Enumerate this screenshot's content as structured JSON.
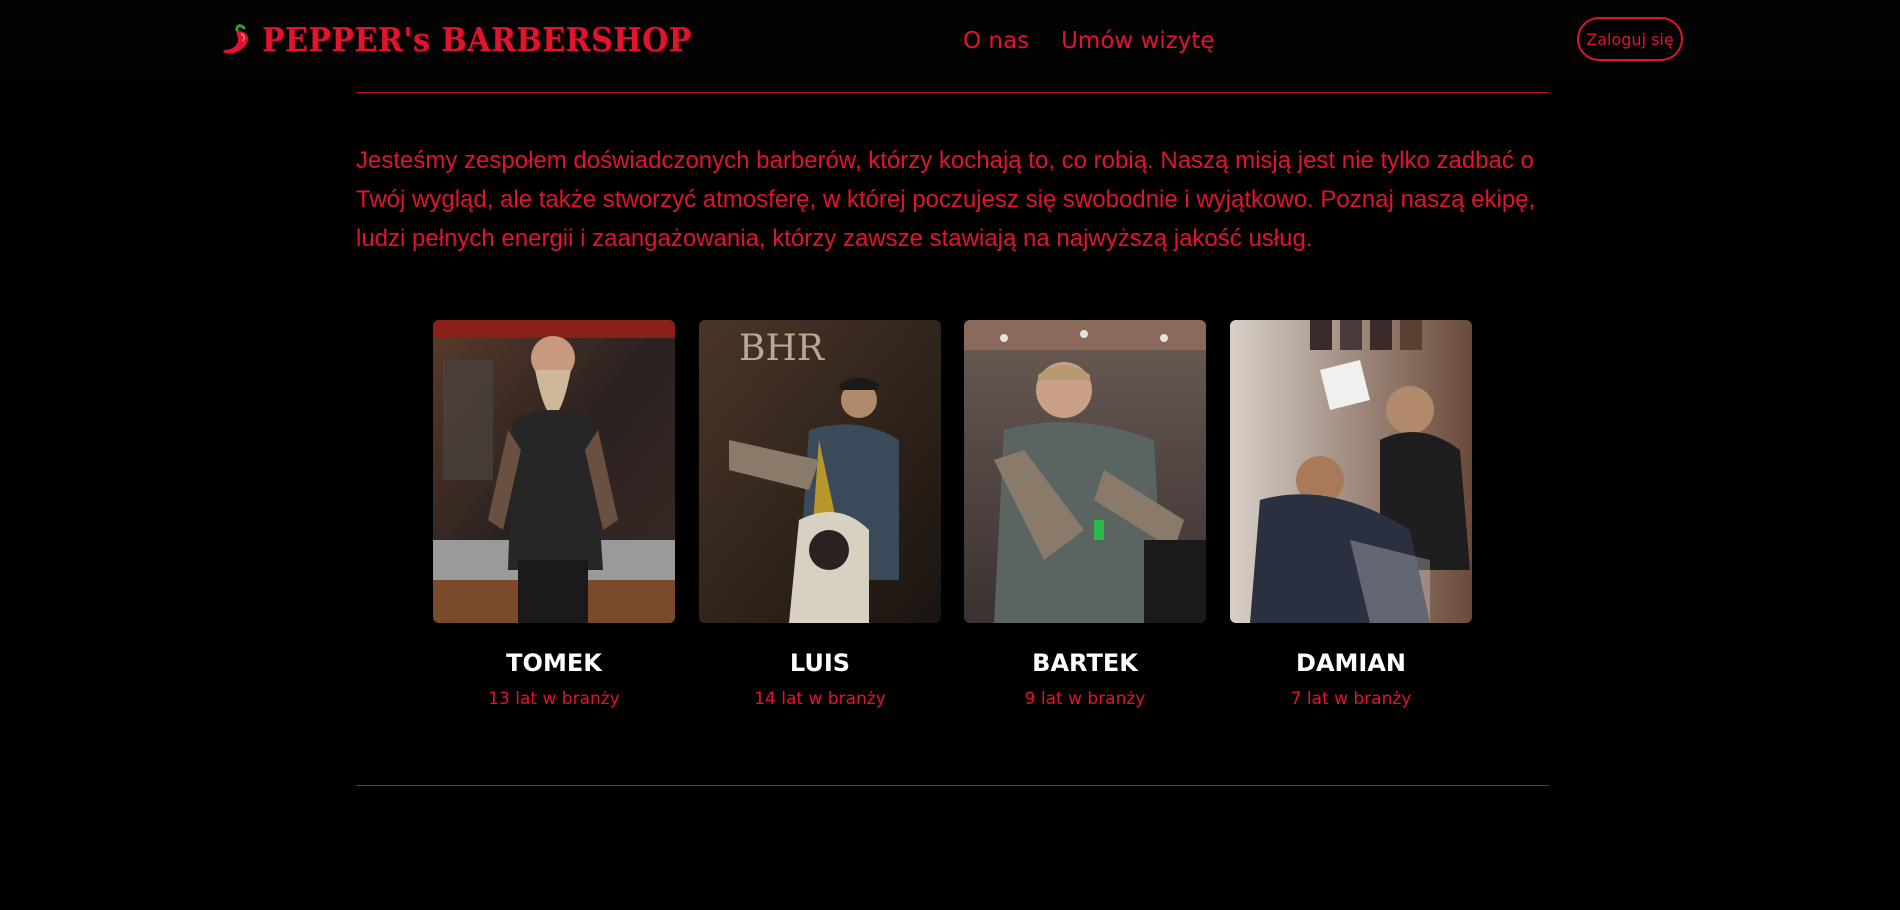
{
  "header": {
    "brand": "PEPPER's BARBERSHOP",
    "logo_icon": "chili-pepper-icon",
    "nav": [
      {
        "label": "O nas"
      },
      {
        "label": "Umów wizytę"
      }
    ],
    "login_label": "Zaloguj się"
  },
  "intro": {
    "text": "Jesteśmy zespołem doświadczonych barberów, którzy kochają to, co robią. Naszą misją jest nie tylko zadbać o Twój wygląd, ale także stworzyć atmosferę, w której poczujesz się swobodnie i wyjątkowo. Poznaj naszą ekipę, ludzi pełnych energii i zaangażowania, którzy zawsze stawiają na najwyższą jakość usług."
  },
  "team": [
    {
      "name": "TOMEK",
      "experience": "13 lat w branży"
    },
    {
      "name": "LUIS",
      "experience": "14 lat w branży"
    },
    {
      "name": "BARTEK",
      "experience": "9 lat w branży"
    },
    {
      "name": "DAMIAN",
      "experience": "7 lat w branży"
    }
  ],
  "colors": {
    "accent": "#e0142c",
    "background": "#000000",
    "name_text": "#ffffff"
  }
}
